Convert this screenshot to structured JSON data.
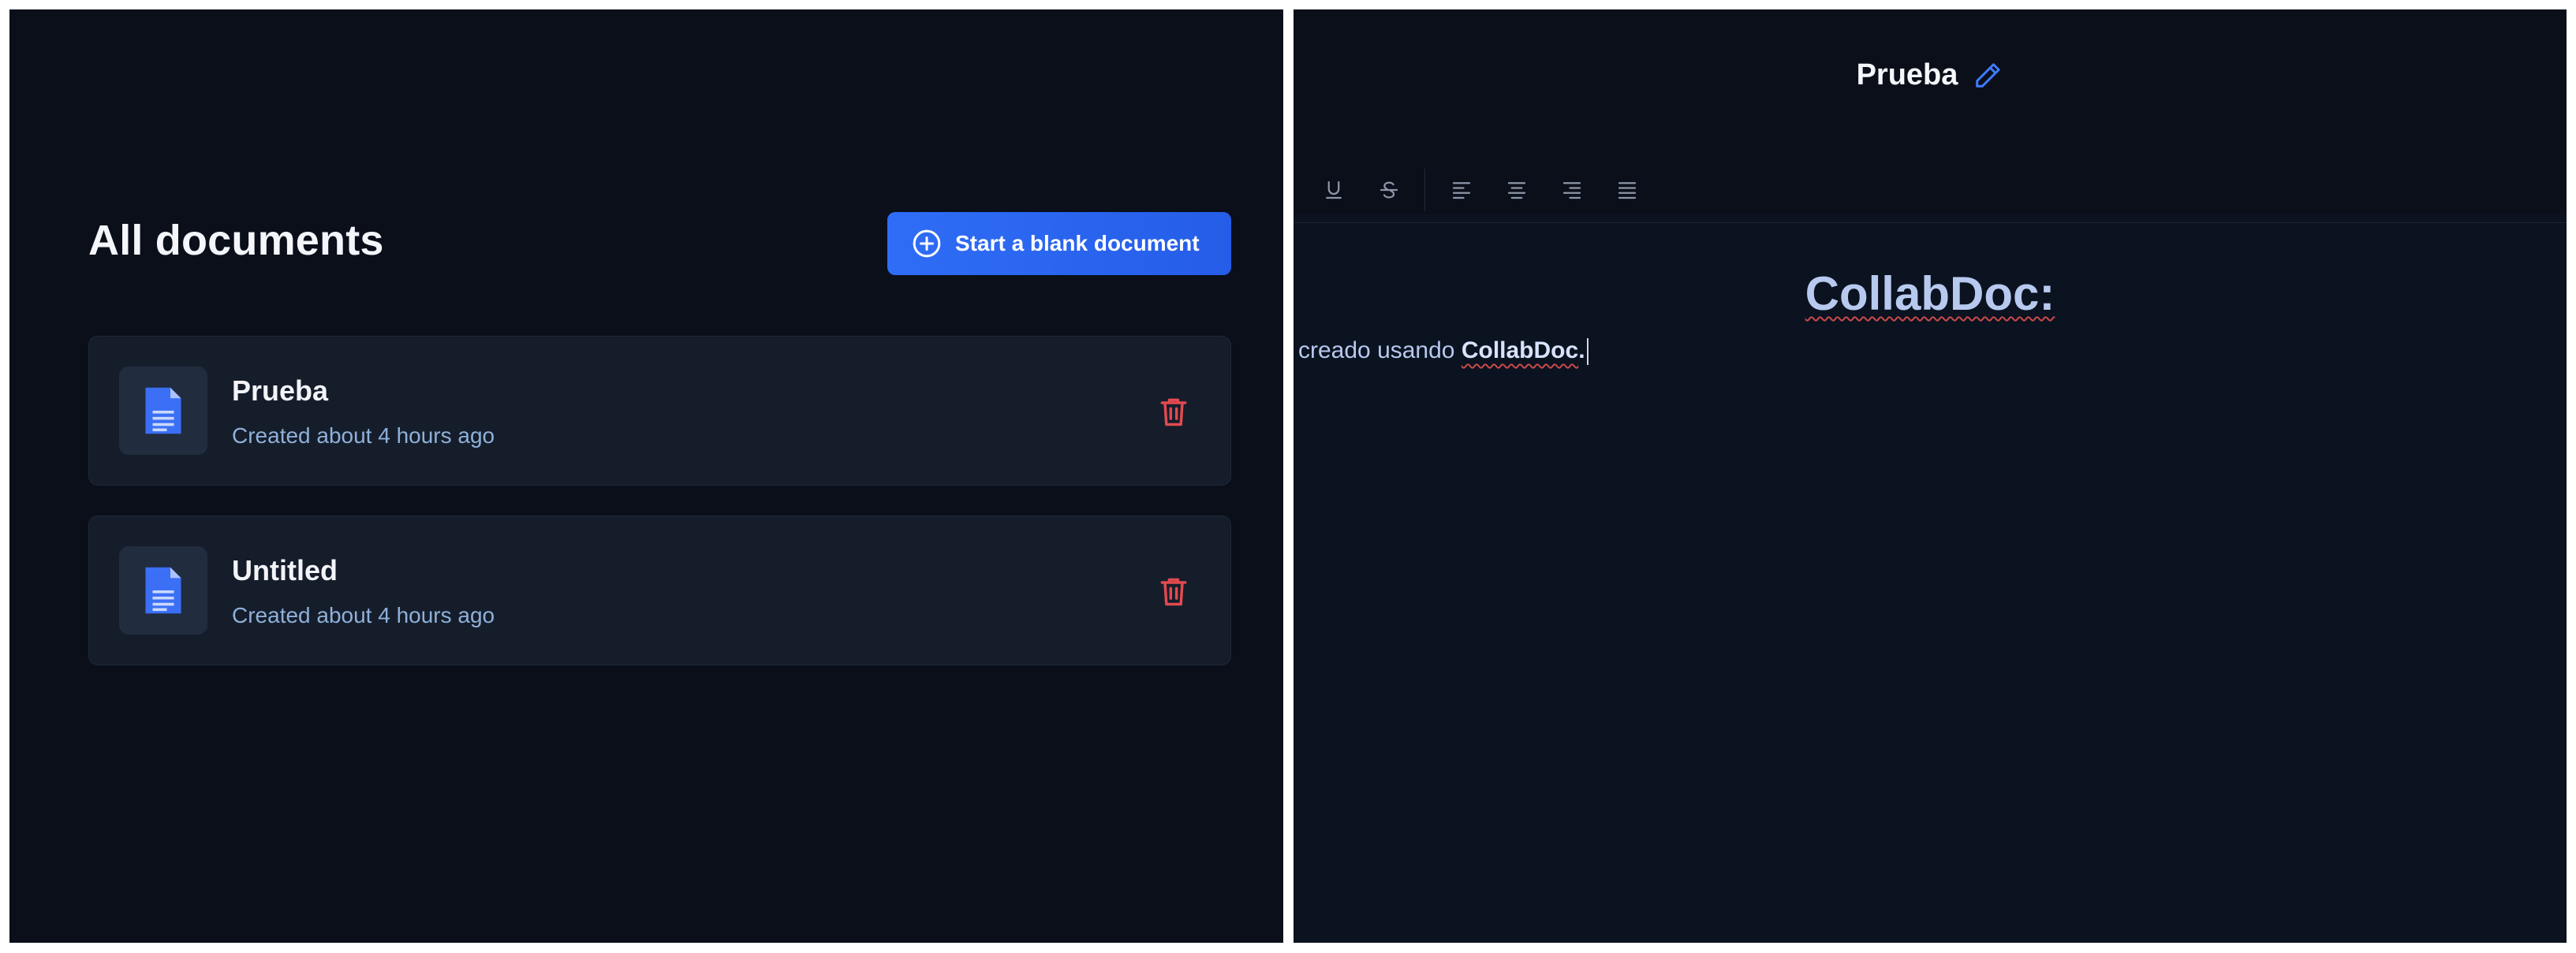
{
  "dashboard": {
    "title": "All documents",
    "new_doc_button": "Start a blank document",
    "documents": [
      {
        "name": "Prueba",
        "meta": "Created about 4 hours ago"
      },
      {
        "name": "Untitled",
        "meta": "Created about 4 hours ago"
      }
    ]
  },
  "editor": {
    "doc_title": "Prueba",
    "toolbar": [
      "underline-icon",
      "strikethrough-icon",
      "align-left-icon",
      "align-center-icon",
      "align-right-icon",
      "align-justify-icon"
    ],
    "heading": "CollabDoc:",
    "paragraph": {
      "prefix": "creado usando ",
      "bold": "CollabDoc",
      "suffix": "."
    }
  },
  "colors": {
    "accent": "#2f6df6",
    "danger": "#e14a4f",
    "background": "#0a0f1a",
    "editor_background": "#0b1220",
    "editor_text": "#b7c9ee"
  }
}
